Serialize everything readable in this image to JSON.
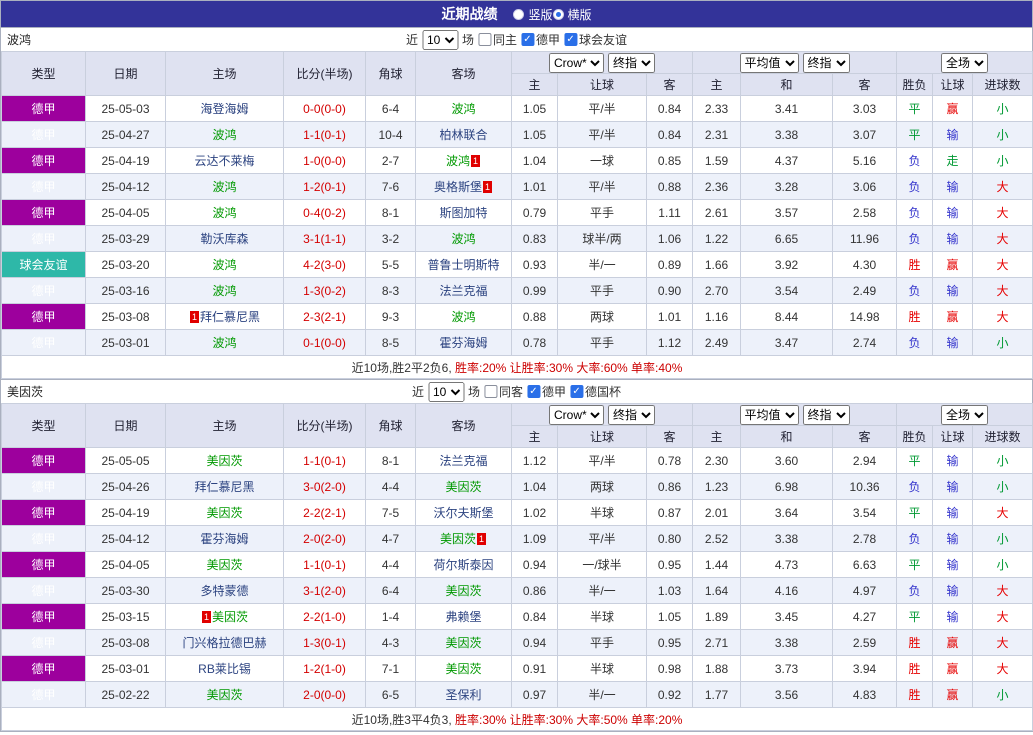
{
  "topbar": {
    "title": "近期战绩",
    "radios": [
      {
        "label": "竖版",
        "selected": false
      },
      {
        "label": "横版",
        "selected": true
      }
    ]
  },
  "table_headers": {
    "left": [
      "类型",
      "日期",
      "主场",
      "比分(半场)",
      "角球",
      "客场"
    ],
    "odds_group": {
      "select1": "Crow*",
      "select2": "终指",
      "cols": [
        "主",
        "让球",
        "客"
      ]
    },
    "avg_group": {
      "select1": "平均值",
      "select2": "终指",
      "cols": [
        "主",
        "和",
        "客"
      ]
    },
    "full_group": {
      "select1": "全场",
      "cols": [
        "胜负",
        "让球",
        "进球数"
      ]
    }
  },
  "colors": {
    "league": "#9d009d",
    "friendly": "#2eb8a8",
    "self_team": "#009900",
    "opponent": "#2c4380",
    "win": "#e60000",
    "draw": "#009933",
    "loss": "#3333cc",
    "score": "#d40000"
  },
  "sections": [
    {
      "team": "波鸿",
      "filter": {
        "near": "近",
        "count": "10",
        "games": "场",
        "checkboxes": [
          {
            "label": "同主",
            "checked": false
          },
          {
            "label": "德甲",
            "checked": true
          },
          {
            "label": "球会友谊",
            "checked": true
          }
        ]
      },
      "rows": [
        {
          "league": "德甲",
          "friendly": false,
          "date": "25-05-03",
          "home": "海登海姆",
          "home_self": false,
          "home_card": "",
          "away": "波鸿",
          "away_self": true,
          "away_card": "",
          "score": "0-0(0-0)",
          "corner": "6-4",
          "odds": [
            "1.05",
            "平/半",
            "0.84"
          ],
          "avg": [
            "2.33",
            "3.41",
            "3.03"
          ],
          "res": [
            "平",
            "赢",
            "小"
          ]
        },
        {
          "league": "德甲",
          "friendly": false,
          "date": "25-04-27",
          "home": "波鸿",
          "home_self": true,
          "home_card": "",
          "away": "柏林联合",
          "away_self": false,
          "away_card": "",
          "score": "1-1(0-1)",
          "corner": "10-4",
          "odds": [
            "1.05",
            "平/半",
            "0.84"
          ],
          "avg": [
            "2.31",
            "3.38",
            "3.07"
          ],
          "res": [
            "平",
            "输",
            "小"
          ]
        },
        {
          "league": "德甲",
          "friendly": false,
          "date": "25-04-19",
          "home": "云达不莱梅",
          "home_self": false,
          "home_card": "",
          "away": "波鸿",
          "away_self": true,
          "away_card": "1",
          "score": "1-0(0-0)",
          "corner": "2-7",
          "odds": [
            "1.04",
            "一球",
            "0.85"
          ],
          "avg": [
            "1.59",
            "4.37",
            "5.16"
          ],
          "res": [
            "负",
            "走",
            "小"
          ]
        },
        {
          "league": "德甲",
          "friendly": false,
          "date": "25-04-12",
          "home": "波鸿",
          "home_self": true,
          "home_card": "",
          "away": "奥格斯堡",
          "away_self": false,
          "away_card": "1",
          "score": "1-2(0-1)",
          "corner": "7-6",
          "odds": [
            "1.01",
            "平/半",
            "0.88"
          ],
          "avg": [
            "2.36",
            "3.28",
            "3.06"
          ],
          "res": [
            "负",
            "输",
            "大"
          ]
        },
        {
          "league": "德甲",
          "friendly": false,
          "date": "25-04-05",
          "home": "波鸿",
          "home_self": true,
          "home_card": "",
          "away": "斯图加特",
          "away_self": false,
          "away_card": "",
          "score": "0-4(0-2)",
          "corner": "8-1",
          "odds": [
            "0.79",
            "平手",
            "1.11"
          ],
          "avg": [
            "2.61",
            "3.57",
            "2.58"
          ],
          "res": [
            "负",
            "输",
            "大"
          ]
        },
        {
          "league": "德甲",
          "friendly": false,
          "date": "25-03-29",
          "home": "勒沃库森",
          "home_self": false,
          "home_card": "",
          "away": "波鸿",
          "away_self": true,
          "away_card": "",
          "score": "3-1(1-1)",
          "corner": "3-2",
          "odds": [
            "0.83",
            "球半/两",
            "1.06"
          ],
          "avg": [
            "1.22",
            "6.65",
            "11.96"
          ],
          "res": [
            "负",
            "输",
            "大"
          ]
        },
        {
          "league": "球会友谊",
          "friendly": true,
          "date": "25-03-20",
          "home": "波鸿",
          "home_self": true,
          "home_card": "",
          "away": "普鲁士明斯特",
          "away_self": false,
          "away_card": "",
          "score": "4-2(3-0)",
          "corner": "5-5",
          "odds": [
            "0.93",
            "半/一",
            "0.89"
          ],
          "avg": [
            "1.66",
            "3.92",
            "4.30"
          ],
          "res": [
            "胜",
            "赢",
            "大"
          ]
        },
        {
          "league": "德甲",
          "friendly": false,
          "date": "25-03-16",
          "home": "波鸿",
          "home_self": true,
          "home_card": "",
          "away": "法兰克福",
          "away_self": false,
          "away_card": "",
          "score": "1-3(0-2)",
          "corner": "8-3",
          "odds": [
            "0.99",
            "平手",
            "0.90"
          ],
          "avg": [
            "2.70",
            "3.54",
            "2.49"
          ],
          "res": [
            "负",
            "输",
            "大"
          ]
        },
        {
          "league": "德甲",
          "friendly": false,
          "date": "25-03-08",
          "home": "拜仁慕尼黑",
          "home_self": false,
          "home_card": "1",
          "away": "波鸿",
          "away_self": true,
          "away_card": "",
          "score": "2-3(2-1)",
          "corner": "9-3",
          "odds": [
            "0.88",
            "两球",
            "1.01"
          ],
          "avg": [
            "1.16",
            "8.44",
            "14.98"
          ],
          "res": [
            "胜",
            "赢",
            "大"
          ]
        },
        {
          "league": "德甲",
          "friendly": false,
          "date": "25-03-01",
          "home": "波鸿",
          "home_self": true,
          "home_card": "",
          "away": "霍芬海姆",
          "away_self": false,
          "away_card": "",
          "score": "0-1(0-0)",
          "corner": "8-5",
          "odds": [
            "0.78",
            "平手",
            "1.12"
          ],
          "avg": [
            "2.49",
            "3.47",
            "2.74"
          ],
          "res": [
            "负",
            "输",
            "小"
          ]
        }
      ],
      "summary": [
        {
          "text": "近10场,胜2平2负6, ",
          "color": "#333333"
        },
        {
          "text": "胜率:20%",
          "color": "#cc0000"
        },
        {
          "text": " 让胜率:30%",
          "color": "#cc0000"
        },
        {
          "text": " 大率:60%",
          "color": "#cc0000"
        },
        {
          "text": " 单率:40%",
          "color": "#cc0000"
        }
      ]
    },
    {
      "team": "美因茨",
      "filter": {
        "near": "近",
        "count": "10",
        "games": "场",
        "checkboxes": [
          {
            "label": "同客",
            "checked": false
          },
          {
            "label": "德甲",
            "checked": true
          },
          {
            "label": "德国杯",
            "checked": true
          }
        ]
      },
      "rows": [
        {
          "league": "德甲",
          "friendly": false,
          "date": "25-05-05",
          "home": "美因茨",
          "home_self": true,
          "home_card": "",
          "away": "法兰克福",
          "away_self": false,
          "away_card": "",
          "score": "1-1(0-1)",
          "corner": "8-1",
          "odds": [
            "1.12",
            "平/半",
            "0.78"
          ],
          "avg": [
            "2.30",
            "3.60",
            "2.94"
          ],
          "res": [
            "平",
            "输",
            "小"
          ]
        },
        {
          "league": "德甲",
          "friendly": false,
          "date": "25-04-26",
          "home": "拜仁慕尼黑",
          "home_self": false,
          "home_card": "",
          "away": "美因茨",
          "away_self": true,
          "away_card": "",
          "score": "3-0(2-0)",
          "corner": "4-4",
          "odds": [
            "1.04",
            "两球",
            "0.86"
          ],
          "avg": [
            "1.23",
            "6.98",
            "10.36"
          ],
          "res": [
            "负",
            "输",
            "小"
          ]
        },
        {
          "league": "德甲",
          "friendly": false,
          "date": "25-04-19",
          "home": "美因茨",
          "home_self": true,
          "home_card": "",
          "away": "沃尔夫斯堡",
          "away_self": false,
          "away_card": "",
          "score": "2-2(2-1)",
          "corner": "7-5",
          "odds": [
            "1.02",
            "半球",
            "0.87"
          ],
          "avg": [
            "2.01",
            "3.64",
            "3.54"
          ],
          "res": [
            "平",
            "输",
            "大"
          ]
        },
        {
          "league": "德甲",
          "friendly": false,
          "date": "25-04-12",
          "home": "霍芬海姆",
          "home_self": false,
          "home_card": "",
          "away": "美因茨",
          "away_self": true,
          "away_card": "1",
          "score": "2-0(2-0)",
          "corner": "4-7",
          "odds": [
            "1.09",
            "平/半",
            "0.80"
          ],
          "avg": [
            "2.52",
            "3.38",
            "2.78"
          ],
          "res": [
            "负",
            "输",
            "小"
          ]
        },
        {
          "league": "德甲",
          "friendly": false,
          "date": "25-04-05",
          "home": "美因茨",
          "home_self": true,
          "home_card": "",
          "away": "荷尔斯泰因",
          "away_self": false,
          "away_card": "",
          "score": "1-1(0-1)",
          "corner": "4-4",
          "odds": [
            "0.94",
            "一/球半",
            "0.95"
          ],
          "avg": [
            "1.44",
            "4.73",
            "6.63"
          ],
          "res": [
            "平",
            "输",
            "小"
          ]
        },
        {
          "league": "德甲",
          "friendly": false,
          "date": "25-03-30",
          "home": "多特蒙德",
          "home_self": false,
          "home_card": "",
          "away": "美因茨",
          "away_self": true,
          "away_card": "",
          "score": "3-1(2-0)",
          "corner": "6-4",
          "odds": [
            "0.86",
            "半/一",
            "1.03"
          ],
          "avg": [
            "1.64",
            "4.16",
            "4.97"
          ],
          "res": [
            "负",
            "输",
            "大"
          ]
        },
        {
          "league": "德甲",
          "friendly": false,
          "date": "25-03-15",
          "home": "美因茨",
          "home_self": true,
          "home_card": "1",
          "away": "弗赖堡",
          "away_self": false,
          "away_card": "",
          "score": "2-2(1-0)",
          "corner": "1-4",
          "odds": [
            "0.84",
            "半球",
            "1.05"
          ],
          "avg": [
            "1.89",
            "3.45",
            "4.27"
          ],
          "res": [
            "平",
            "输",
            "大"
          ]
        },
        {
          "league": "德甲",
          "friendly": false,
          "date": "25-03-08",
          "home": "门兴格拉德巴赫",
          "home_self": false,
          "home_card": "",
          "away": "美因茨",
          "away_self": true,
          "away_card": "",
          "score": "1-3(0-1)",
          "corner": "4-3",
          "odds": [
            "0.94",
            "平手",
            "0.95"
          ],
          "avg": [
            "2.71",
            "3.38",
            "2.59"
          ],
          "res": [
            "胜",
            "赢",
            "大"
          ]
        },
        {
          "league": "德甲",
          "friendly": false,
          "date": "25-03-01",
          "home": "RB莱比锡",
          "home_self": false,
          "home_card": "",
          "away": "美因茨",
          "away_self": true,
          "away_card": "",
          "score": "1-2(1-0)",
          "corner": "7-1",
          "odds": [
            "0.91",
            "半球",
            "0.98"
          ],
          "avg": [
            "1.88",
            "3.73",
            "3.94"
          ],
          "res": [
            "胜",
            "赢",
            "大"
          ]
        },
        {
          "league": "德甲",
          "friendly": false,
          "date": "25-02-22",
          "home": "美因茨",
          "home_self": true,
          "home_card": "",
          "away": "圣保利",
          "away_self": false,
          "away_card": "",
          "score": "2-0(0-0)",
          "corner": "6-5",
          "odds": [
            "0.97",
            "半/一",
            "0.92"
          ],
          "avg": [
            "1.77",
            "3.56",
            "4.83"
          ],
          "res": [
            "胜",
            "赢",
            "小"
          ]
        }
      ],
      "summary": [
        {
          "text": "近10场,胜3平4负3, ",
          "color": "#333333"
        },
        {
          "text": "胜率:30%",
          "color": "#cc0000"
        },
        {
          "text": " 让胜率:30%",
          "color": "#cc0000"
        },
        {
          "text": " 大率:50%",
          "color": "#cc0000"
        },
        {
          "text": " 单率:20%",
          "color": "#cc0000"
        }
      ]
    }
  ]
}
